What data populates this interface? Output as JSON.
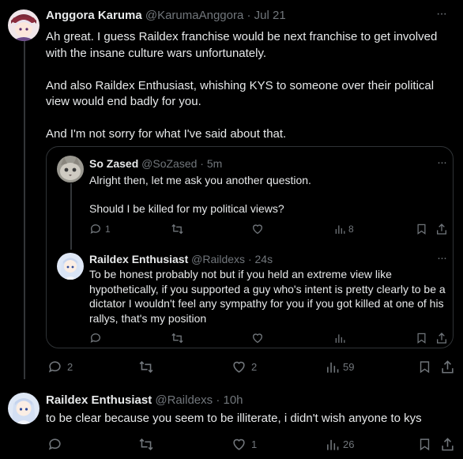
{
  "tweet1": {
    "name": "Anggora Karuma",
    "handle": "@KarumaAnggora",
    "time": "· Jul 21",
    "text": "Ah great. I guess Raildex franchise would be next franchise to get involved\nwith the insane culture wars unfortunately.\n\nAnd also Raildex Enthusiast, whishing KYS to someone over their political\nview would end badly for you.\n\nAnd I'm not sorry for what I've said about that.",
    "actions": {
      "replies": "2",
      "retweets": "",
      "likes": "2",
      "views": "59"
    }
  },
  "quote1": {
    "name": "So Zased",
    "handle": "@SoZased",
    "time": "· 5m",
    "text": "Alright then, let me ask you another question.\n\nShould I be killed for my political views?",
    "actions": {
      "replies": "1",
      "retweets": "",
      "likes": "",
      "views": "8"
    }
  },
  "quote2": {
    "name": "Raildex Enthusiast",
    "handle": "@Raildexs",
    "time": "· 24s",
    "text": "To be honest probably not but if you held an extreme view like\nhypothetically, if you supported a guy who's intent is pretty clearly to be a\ndictator I wouldn't feel any sympathy for you if you got killed at one of his\nrallys, that's my position",
    "actions": {
      "replies": "",
      "retweets": "",
      "likes": "",
      "views": ""
    }
  },
  "tweet2": {
    "name": "Raildex Enthusiast",
    "handle": "@Raildexs",
    "time": "· 10h",
    "text": "to be clear because you seem to be illiterate, i didn't wish anyone to kys",
    "actions": {
      "replies": "",
      "retweets": "",
      "likes": "1",
      "views": "26"
    }
  },
  "more_glyph": "···",
  "colors": {
    "background": "#000000",
    "text": "#e7e9ea",
    "muted": "#71767b",
    "border": "#2f3336"
  }
}
